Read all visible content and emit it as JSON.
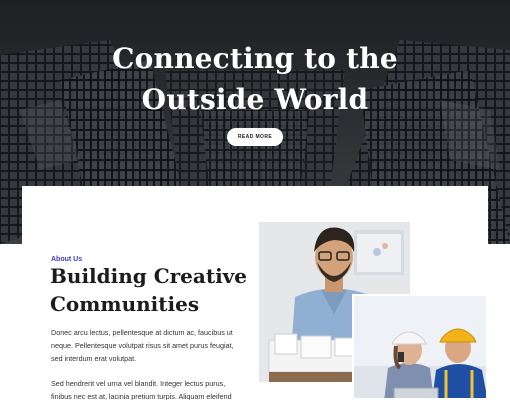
{
  "hero": {
    "title_line1": "Connecting to the",
    "title_line2": "Outside World",
    "cta_label": "READ MORE"
  },
  "about": {
    "eyebrow": "About Us",
    "heading_line1": "Building Creative",
    "heading_line2": "Communities",
    "paragraph1": "Donec arcu lectus, pellentesque at dictum ac, faucibus ut neque. Pellentesque volutpat risus sit amet purus feugiat, sed interdum erat volutpat.",
    "paragraph2": "Sed hendrerit vel urna vel blandit. Integer lectus purus, finibus nec est at, lacinia pretium turpis. Aliquam eleifend"
  },
  "colors": {
    "accent": "#3b3bcf",
    "heading": "#1c1c1c",
    "hero_overlay": "#2b2d31"
  }
}
